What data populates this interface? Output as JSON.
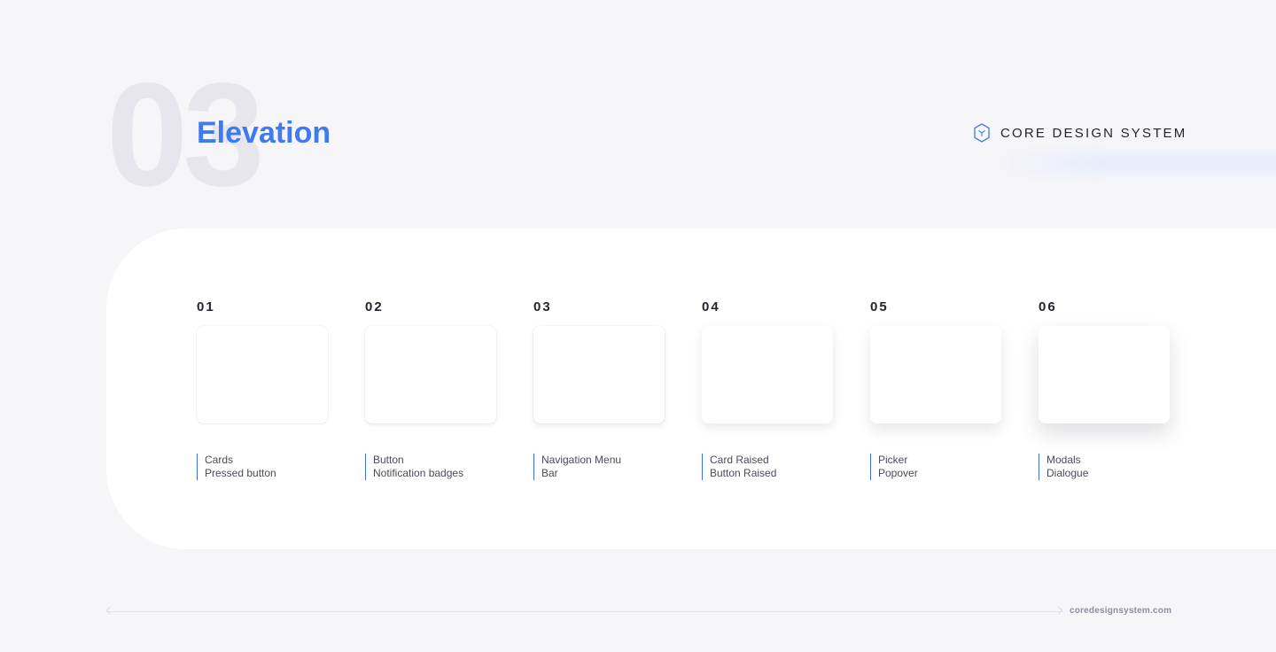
{
  "header": {
    "section_number": "03",
    "title": "Elevation"
  },
  "brand": {
    "name": "CORE DESIGN SYSTEM",
    "icon": "hexagon-cube-icon",
    "accent": "#3f7bef"
  },
  "levels": [
    {
      "number": "01",
      "line1": "Cards",
      "line2": "Pressed button"
    },
    {
      "number": "02",
      "line1": "Button",
      "line2": "Notification badges"
    },
    {
      "number": "03",
      "line1": "Navigation Menu",
      "line2": "Bar"
    },
    {
      "number": "04",
      "line1": "Card Raised",
      "line2": "Button Raised"
    },
    {
      "number": "05",
      "line1": "Picker",
      "line2": "Popover"
    },
    {
      "number": "06",
      "line1": "Modals",
      "line2": "Dialogue"
    }
  ],
  "footer": {
    "url": "coredesignsystem.com"
  },
  "colors": {
    "background": "#f6f6f8",
    "panel": "#ffffff",
    "title": "#3f7bef",
    "divider": "#3f6ddd"
  }
}
